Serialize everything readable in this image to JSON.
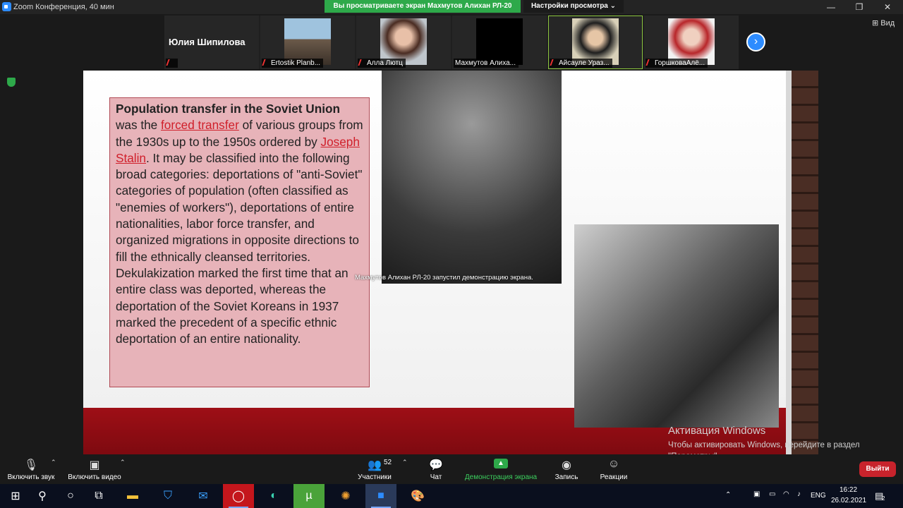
{
  "window": {
    "title": "Zoom Конференция, 40 мин",
    "share_banner": "Вы просматриваете экран Махмутов Алихан РЛ-20",
    "view_options": "Настройки просмотра ⌄",
    "controls": {
      "minimize": "—",
      "restore": "❐",
      "close": "✕"
    }
  },
  "participants": {
    "speaker_name": "Юлия Шипилова",
    "thumbs": [
      {
        "label": "",
        "muted": true
      },
      {
        "label": "Ertostik Planb...",
        "muted": true
      },
      {
        "label": "Алла Лютц",
        "muted": true
      },
      {
        "label": "Махмутов Алиха...",
        "muted": false
      },
      {
        "label": "Айсауле Ураз...",
        "muted": true
      },
      {
        "label": "ГоршковаАлё...",
        "muted": true
      }
    ],
    "next_icon": "›",
    "view_label": "⊞ Вид"
  },
  "slide": {
    "title_part": "Population transfer in the Soviet Union",
    "text_1": " was the ",
    "link_1": "forced transfer",
    "text_2": " of various groups from the 1930s up to the 1950s ordered by ",
    "link_2": "Joseph Stalin",
    "text_3": ". It may be classified into the following broad categories: deportations of \"anti-Soviet\" categories of population (often classified as \"enemies of workers\"), deportations of entire nationalities, labor force transfer, and organized migrations in opposite directions to fill the ethnically cleansed territories. Dekulakization marked the first time that an entire class was deported, whereas the deportation of the Soviet Koreans in 1937 marked the precedent of a specific ethnic deportation of an entire nationality.",
    "overlay_note": "Махмутов Алихан РЛ-20 запустил демонстрацию экрана."
  },
  "activation": {
    "title": "Активация Windows",
    "text": "Чтобы активировать Windows, перейдите в раздел \"Параметры\"."
  },
  "toolbar": {
    "unmute": "Включить звук",
    "start_video": "Включить видео",
    "participants": "Участники",
    "participants_count": "52",
    "chat": "Чат",
    "share": "Демонстрация экрана",
    "record": "Запись",
    "reactions": "Реакции",
    "leave": "Выйти"
  },
  "tray": {
    "lang": "ENG",
    "time": "16:22",
    "date": "26.02.2021",
    "notifications": "2"
  },
  "colors": {
    "zoom_blue": "#2d8cff",
    "share_green": "#2ea94a",
    "leave_red": "#c8232c",
    "slide_red": "#9e0f16"
  }
}
